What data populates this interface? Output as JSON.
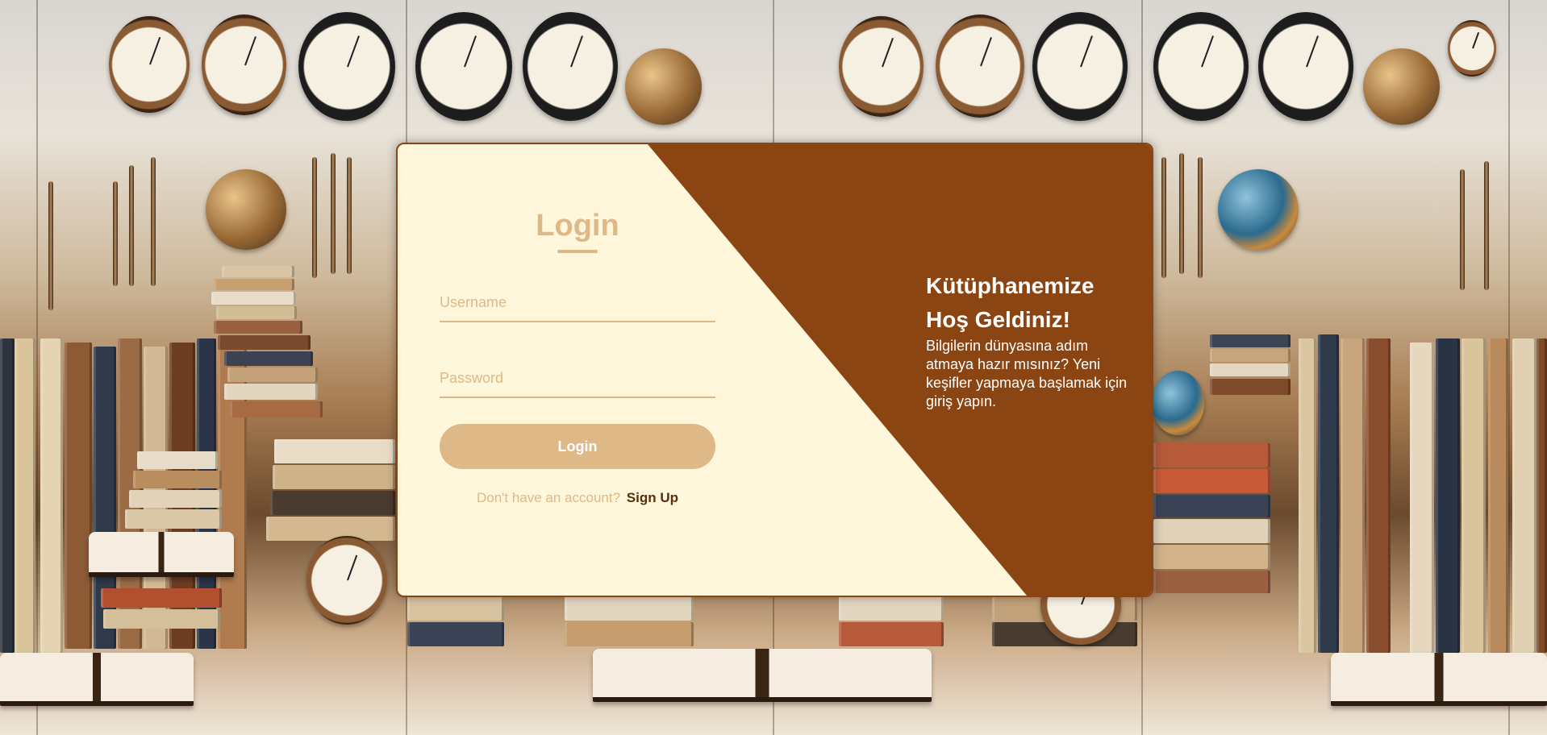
{
  "login": {
    "title": "Login",
    "username_placeholder": "Username",
    "password_placeholder": "Password",
    "button_label": "Login",
    "signup_prompt": "Don't have an account?",
    "signup_link": "Sign Up"
  },
  "welcome": {
    "title": "Kütüphanemize Hoş Geldiniz!",
    "text": "Bilgilerin dünyasına adım atmaya hazır mısınız? Yeni keşifler yapmaya başlamak için giriş yapın."
  },
  "colors": {
    "card_background": "#fff7dc",
    "accent_brown": "#8b4513",
    "tan": "#deb887",
    "link_dark": "#5a2d0c"
  },
  "background_icons": [
    "alarm-clock-icon",
    "pencil-icon",
    "book-icon",
    "open-book-icon",
    "globe-icon"
  ]
}
